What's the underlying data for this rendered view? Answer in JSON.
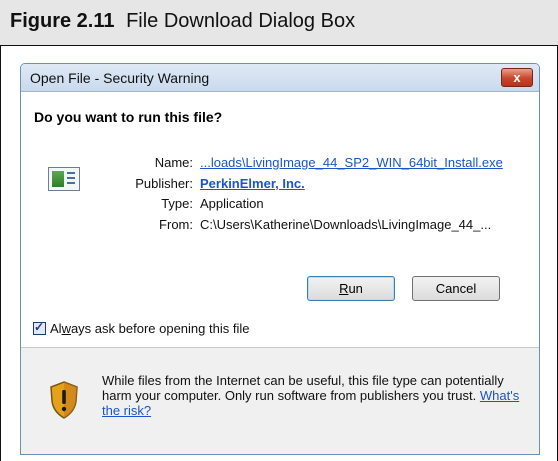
{
  "figure": {
    "number": "Figure 2.11",
    "caption": "File Download Dialog Box"
  },
  "dialog": {
    "title": "Open File - Security Warning",
    "close_label": "x",
    "question": "Do you want to run this file?",
    "icon": "application-file-icon",
    "fields": [
      {
        "label": "Name:",
        "value": "...loads\\LivingImage_44_SP2_WIN_64bit_Install.exe",
        "is_link": true
      },
      {
        "label": "Publisher:",
        "value": "PerkinElmer, Inc.",
        "is_link": true
      },
      {
        "label": "Type:",
        "value": "Application",
        "is_link": false
      },
      {
        "label": "From:",
        "value": "C:\\Users\\Katherine\\Downloads\\LivingImage_44_...",
        "is_link": false
      }
    ],
    "buttons": {
      "run_accel": "R",
      "run_rest": "un",
      "cancel": "Cancel"
    },
    "checkbox": {
      "checked": true,
      "label_pre": "Al",
      "label_accel": "w",
      "label_post": "ays ask before opening this file"
    },
    "warning": {
      "icon": "security-shield-icon",
      "text": "While files from the Internet can be useful, this file type can potentially harm your computer. Only run software from publishers you trust.",
      "link": "What's the risk?"
    }
  }
}
